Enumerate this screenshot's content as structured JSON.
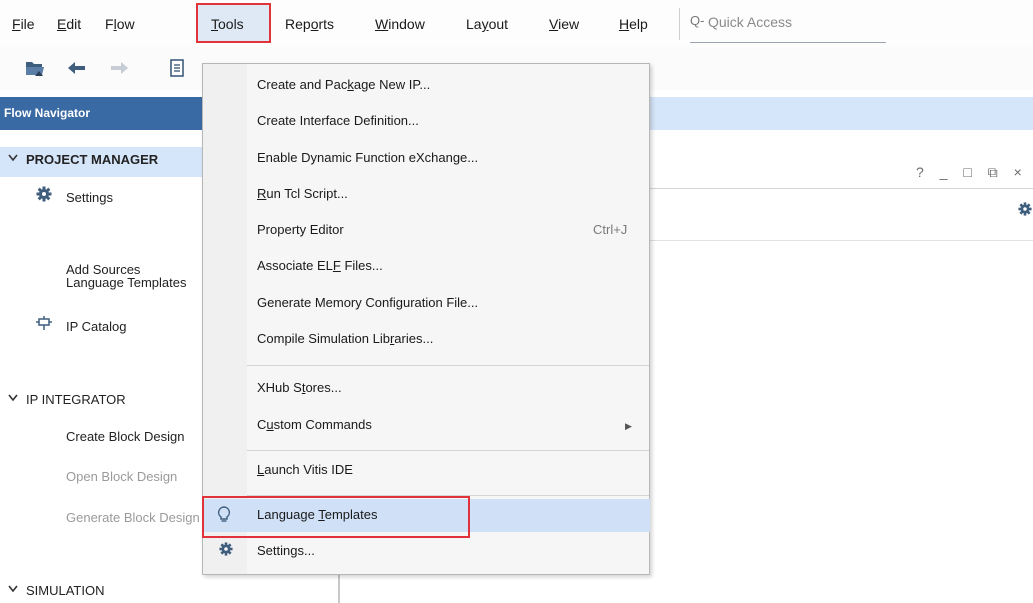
{
  "menubar": {
    "items": [
      {
        "pre": "",
        "u": "F",
        "post": "ile"
      },
      {
        "pre": "",
        "u": "E",
        "post": "dit"
      },
      {
        "pre": "F",
        "u": "l",
        "post": "ow"
      },
      {
        "pre": "",
        "u": "T",
        "post": "ools"
      },
      {
        "pre": "Rep",
        "u": "o",
        "post": "rts"
      },
      {
        "pre": "",
        "u": "W",
        "post": "indow"
      },
      {
        "pre": "La",
        "u": "y",
        "post": "out"
      },
      {
        "pre": "",
        "u": "V",
        "post": "iew"
      },
      {
        "pre": "",
        "u": "H",
        "post": "elp"
      }
    ],
    "quick_access": {
      "icon": "Q-",
      "text": "Quick Access"
    }
  },
  "toolbar": {
    "icons": [
      "open-project-icon",
      "undo-icon",
      "redo-icon",
      "document-icon"
    ]
  },
  "flow_navigator": {
    "title": "Flow Navigator",
    "sections": [
      {
        "title": "PROJECT MANAGER",
        "items": [
          {
            "label": "Settings",
            "icon": "gear-icon"
          },
          {
            "label": "Add Sources",
            "icon": ""
          },
          {
            "label": "Language Templates",
            "icon": ""
          },
          {
            "label": "IP Catalog",
            "icon": "ip-catalog-icon"
          }
        ]
      },
      {
        "title": "IP INTEGRATOR",
        "items": [
          {
            "label": "Create Block Design",
            "icon": ""
          },
          {
            "label": "Open Block Design",
            "icon": "",
            "disabled": true
          },
          {
            "label": "Generate Block Design",
            "icon": "",
            "disabled": true
          }
        ]
      },
      {
        "title": "SIMULATION",
        "items": []
      }
    ]
  },
  "right_panel": {
    "window_controls": "? _ □ ⧉ ×"
  },
  "dropdown": {
    "items": [
      {
        "pre": "Create and Pac",
        "u": "k",
        "post": "age New IP..."
      },
      {
        "pre": "Create Interface Definition...",
        "u": "",
        "post": ""
      },
      {
        "pre": "Enable Dynamic Function eXchange...",
        "u": "",
        "post": ""
      },
      {
        "pre": "",
        "u": "R",
        "post": "un Tcl Script..."
      },
      {
        "pre": "Property Editor",
        "u": "",
        "post": "",
        "shortcut": "Ctrl+J"
      },
      {
        "pre": "Associate EL",
        "u": "F",
        "post": " Files..."
      },
      {
        "pre": "Generate Memory Confi",
        "u": "g",
        "post": "uration File..."
      },
      {
        "pre": "Compile Simulation Lib",
        "u": "r",
        "post": "aries..."
      },
      {
        "pre": "XHub S",
        "u": "t",
        "post": "ores..."
      },
      {
        "pre": "C",
        "u": "u",
        "post": "stom Commands",
        "submenu": true
      },
      {
        "pre": "",
        "u": "L",
        "post": "aunch Vitis IDE"
      },
      {
        "pre": "Language ",
        "u": "T",
        "post": "emplates",
        "highlighted": true
      },
      {
        "pre": "Settings...",
        "u": "",
        "post": ""
      }
    ]
  }
}
